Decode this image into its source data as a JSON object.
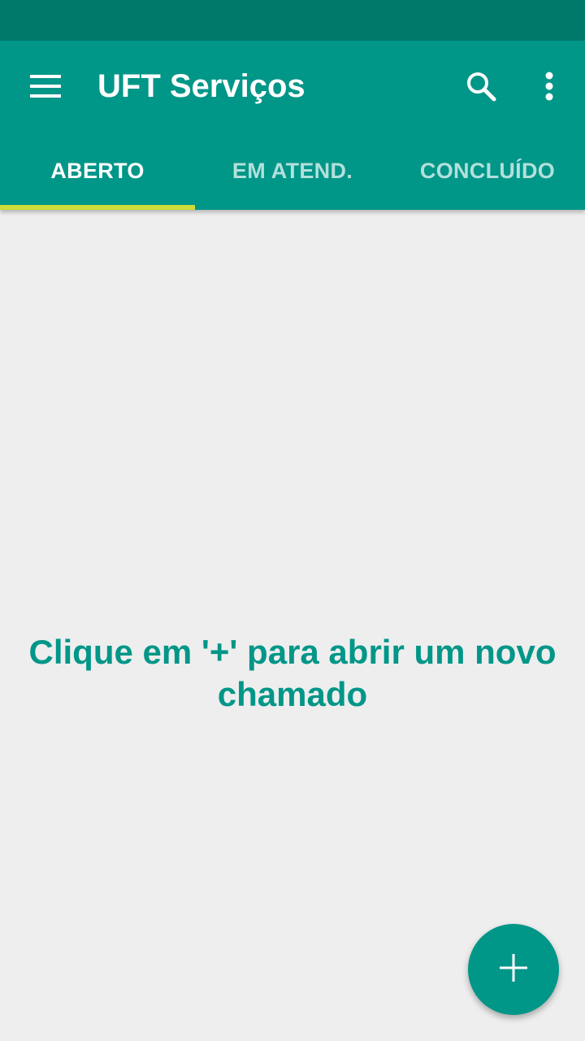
{
  "app": {
    "title": "UFT Serviços"
  },
  "toolbar": {
    "menu_icon": "hamburger-menu-icon",
    "search_icon": "search-icon",
    "overflow_icon": "more-vert-icon"
  },
  "tabs": [
    {
      "label": "ABERTO",
      "selected": true
    },
    {
      "label": "EM ATEND.",
      "selected": false
    },
    {
      "label": "CONCLUÍDO",
      "selected": false
    }
  ],
  "empty_state": {
    "message": "Clique em '+' para abrir um novo chamado"
  },
  "fab": {
    "icon": "add-icon"
  },
  "colors": {
    "status_bar": "#00796b",
    "primary": "#009688",
    "tab_indicator": "#cddc39",
    "background": "#eeeeee",
    "on_primary": "#ffffff"
  }
}
